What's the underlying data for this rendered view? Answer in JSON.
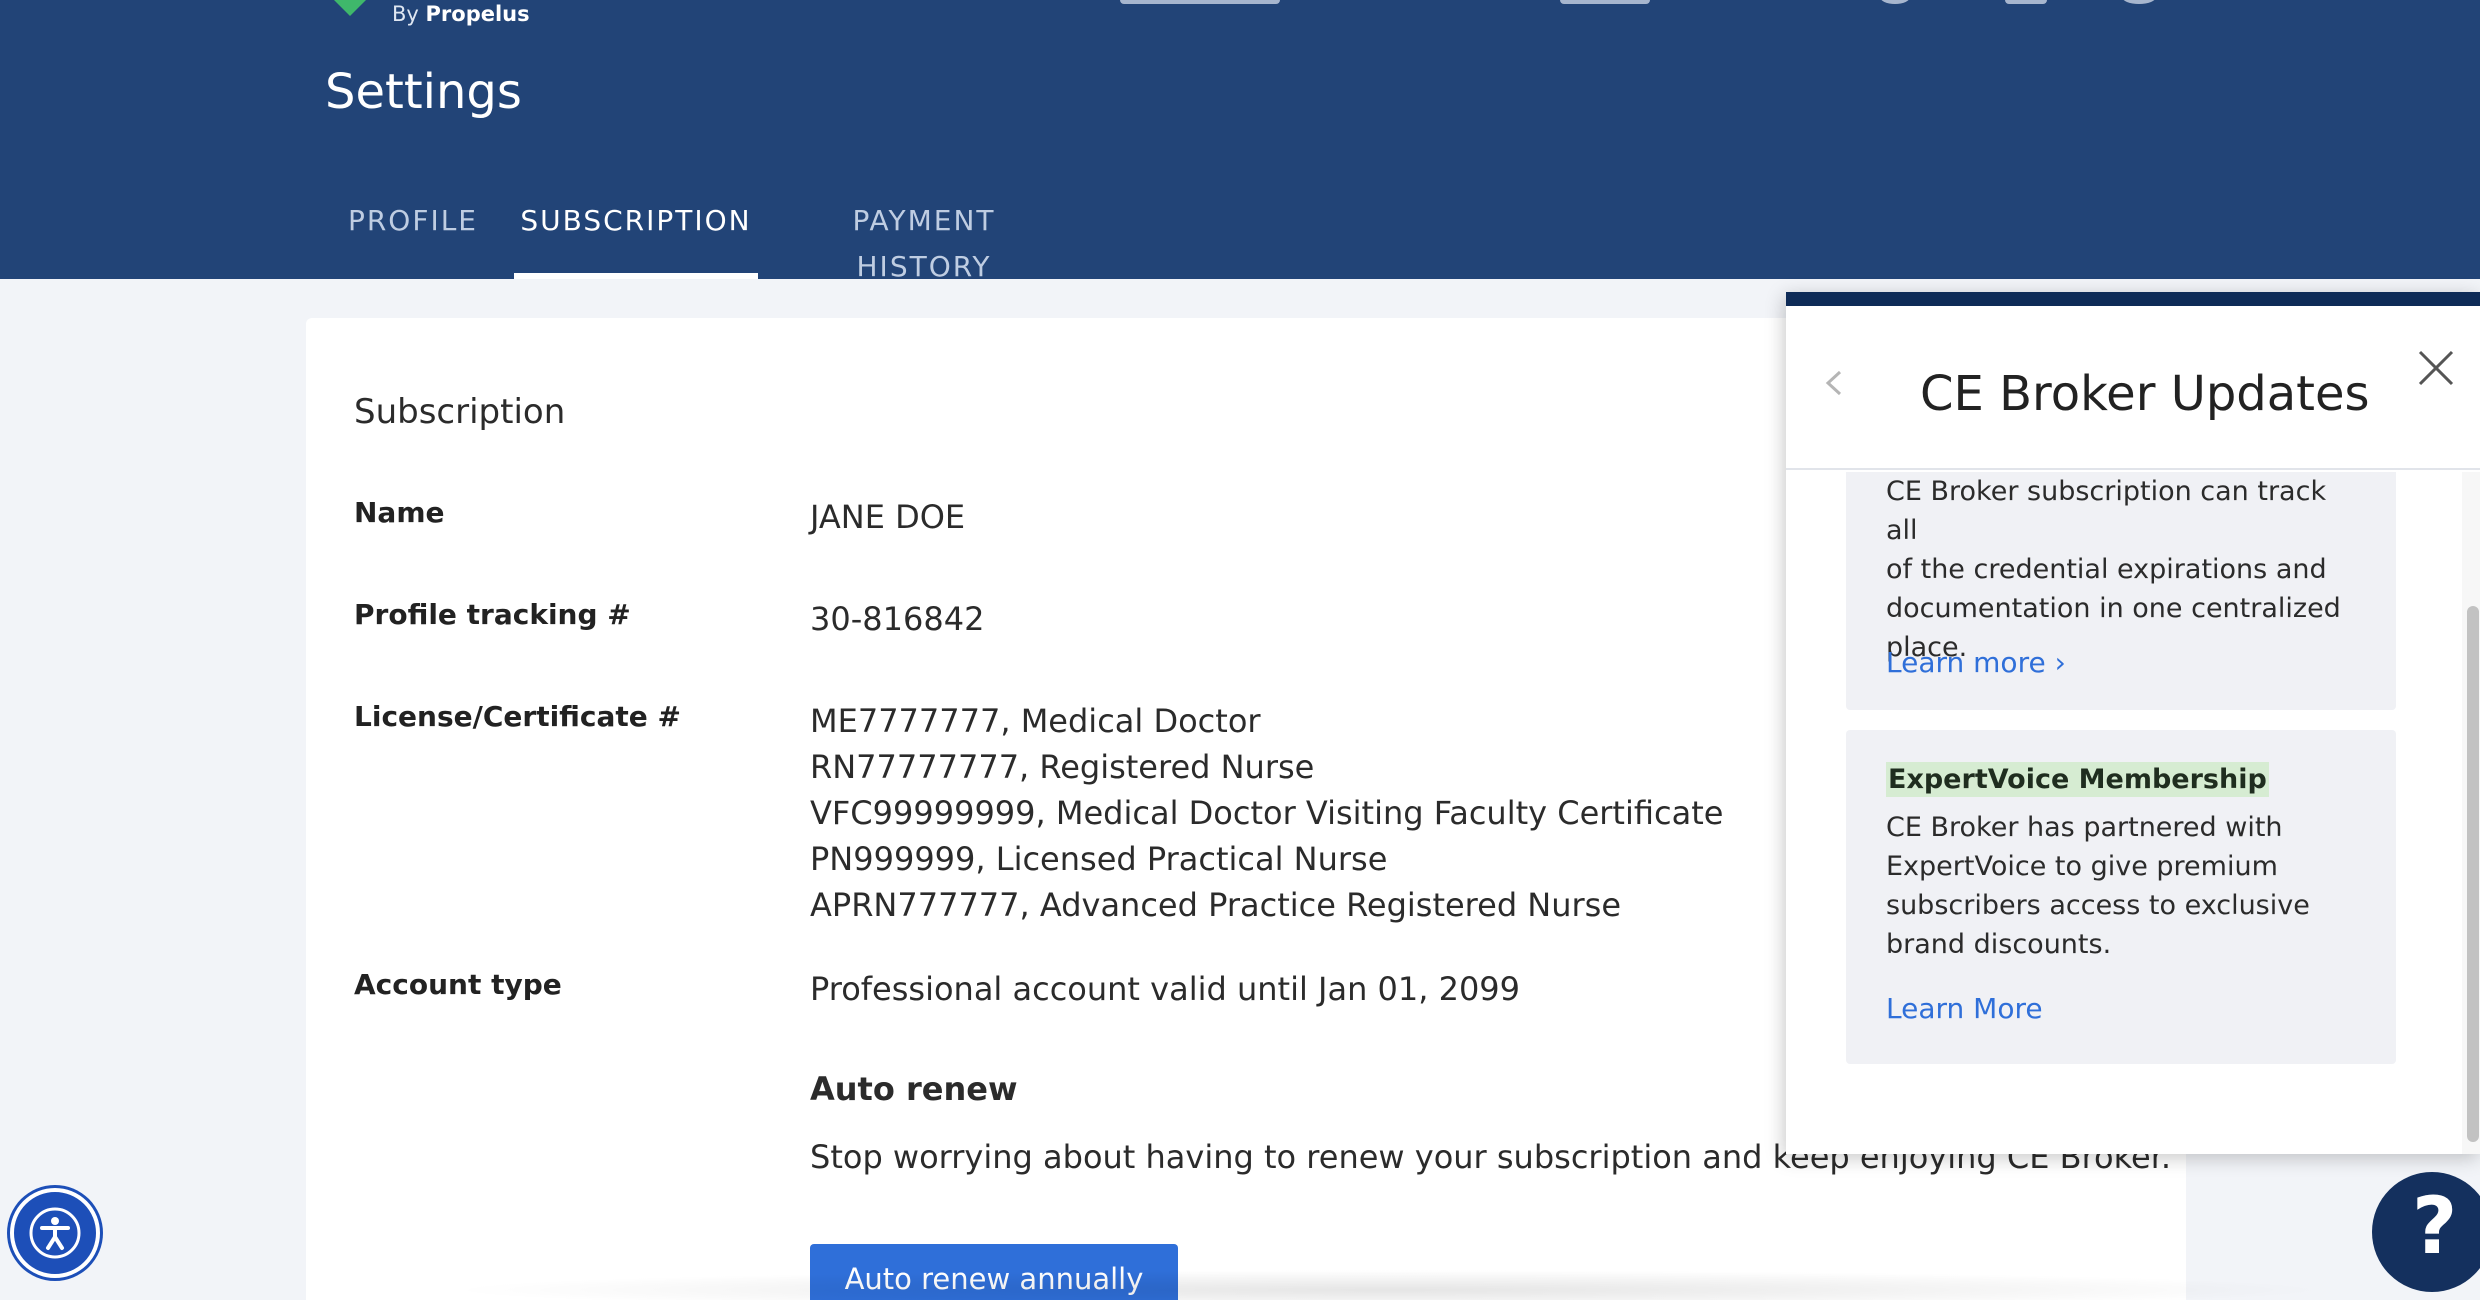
{
  "brand": {
    "by_prefix": "By",
    "by_name": "Propelus"
  },
  "page": {
    "title": "Settings"
  },
  "tabs": [
    {
      "label": "PROFILE",
      "active": false
    },
    {
      "label": "SUBSCRIPTION",
      "active": true
    },
    {
      "label": "PAYMENT HISTORY",
      "active": false
    }
  ],
  "subscription": {
    "section_title": "Subscription",
    "name_label": "Name",
    "name_value": "JANE DOE",
    "tracking_label": "Profile tracking #",
    "tracking_value": "30-816842",
    "license_label": "License/Certificate #",
    "licenses": [
      "ME7777777, Medical Doctor",
      "RN77777777, Registered Nurse",
      "VFC99999999, Medical Doctor Visiting Faculty Certificate",
      "PN999999, Licensed Practical Nurse",
      "APRN777777, Advanced Practice Registered Nurse"
    ],
    "account_type_label": "Account type",
    "account_type_value": "Professional account valid until Jan 01, 2099",
    "auto_renew_title": "Auto renew",
    "auto_renew_desc": "Stop worrying about having to renew your subscription and keep enjoying CE Broker.",
    "auto_renew_button": "Auto renew annually"
  },
  "updates_panel": {
    "title": "CE Broker Updates",
    "cards": [
      {
        "text_lines": [
          "CE Broker subscription can track all",
          "of the credential expirations and",
          "documentation in one centralized",
          "place."
        ],
        "link": "Learn more ›"
      },
      {
        "heading": "ExpertVoice Membership",
        "text_lines": [
          "CE Broker has partnered with",
          "ExpertVoice to give premium",
          "subscribers access to exclusive",
          "brand discounts."
        ],
        "link": "Learn More"
      }
    ]
  },
  "icons": {
    "back": "chevron-left-icon",
    "close": "close-icon",
    "accessibility": "accessibility-icon",
    "help": "help-icon"
  },
  "colors": {
    "header_bg": "#224477",
    "primary_button": "#2f6fd9",
    "link": "#2f6fd9",
    "panel_top_border": "#0e2b57",
    "highlight": "#d6ecd2",
    "help_button": "#14305e",
    "accessibility_button": "#1d4fb8"
  }
}
